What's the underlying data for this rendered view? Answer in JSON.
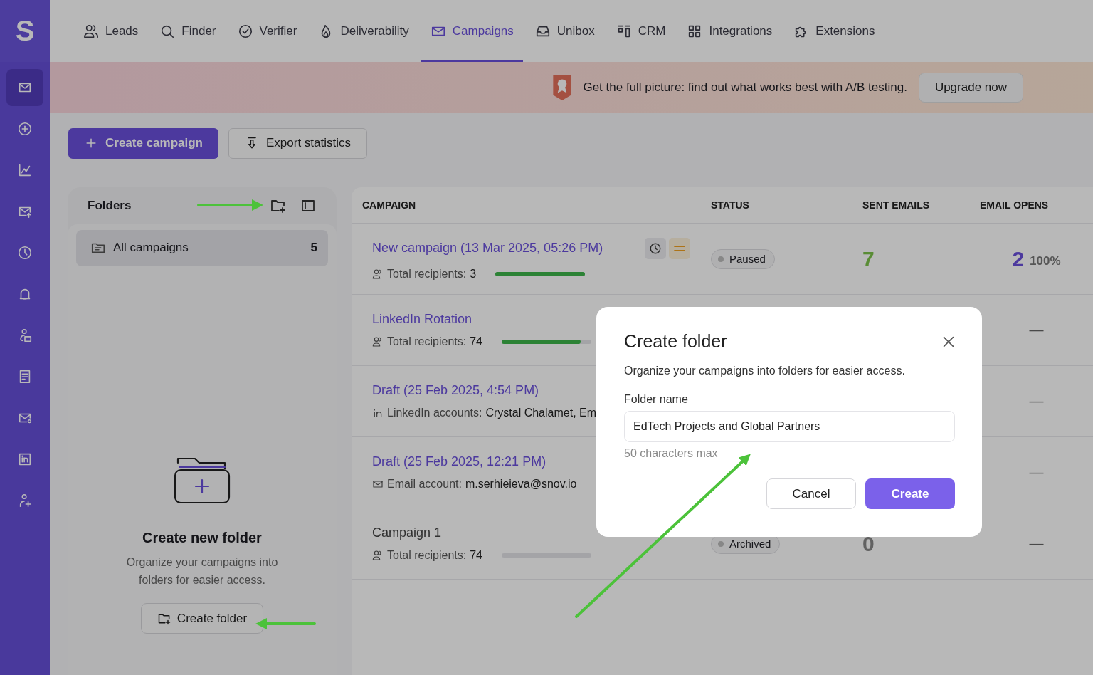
{
  "top_nav": {
    "logo": "S",
    "tabs": [
      {
        "label": "Leads",
        "selected": false
      },
      {
        "label": "Finder",
        "selected": false
      },
      {
        "label": "Verifier",
        "selected": false
      },
      {
        "label": "Deliverability",
        "selected": false
      },
      {
        "label": "Campaigns",
        "selected": true
      },
      {
        "label": "Unibox",
        "selected": false
      },
      {
        "label": "CRM",
        "selected": false
      },
      {
        "label": "Integrations",
        "selected": false
      },
      {
        "label": "Extensions",
        "selected": false
      }
    ]
  },
  "sidebar": {
    "items": [
      {
        "selected": true
      },
      {
        "selected": false
      },
      {
        "selected": false
      },
      {
        "selected": false
      },
      {
        "selected": false
      },
      {
        "selected": false
      },
      {
        "selected": false
      },
      {
        "selected": false
      },
      {
        "selected": false
      },
      {
        "selected": false
      },
      {
        "selected": false
      }
    ]
  },
  "banner": {
    "text": "Get the full picture: find out what works best with A/B testing.",
    "button": "Upgrade now"
  },
  "toolbar": {
    "buttons": [
      {
        "label": "Create campaign",
        "kind": "primary"
      },
      {
        "label": "Export statistics",
        "kind": "secondary"
      }
    ]
  },
  "folders": {
    "title": "Folders",
    "items": [
      {
        "label": "All campaigns",
        "count": "5",
        "selected": true
      }
    ],
    "empty_state": {
      "title": "Create new folder",
      "text": "Organize your campaigns into folders for easier access.",
      "button": "Create folder"
    }
  },
  "table": {
    "columns": [
      "CAMPAIGN",
      "STATUS",
      "SENT EMAILS",
      "EMAIL OPENS"
    ],
    "rows": [
      {
        "name": "New campaign (13 Mar 2025, 05:26 PM)",
        "archived": false,
        "actions": true,
        "detail": {
          "kind": "recipients",
          "label": "Total recipients:",
          "value": "3"
        },
        "level": 1,
        "status": "Paused",
        "sent": "7",
        "opens": "2",
        "open_rate": "100%"
      },
      {
        "name": "LinkedIn Rotation",
        "archived": false,
        "detail": {
          "kind": "recipients",
          "label": "Total recipients:",
          "value": "74"
        },
        "level": 0.88,
        "opens": "—"
      },
      {
        "name": "Draft (25 Feb 2025, 4:54 PM)",
        "archived": false,
        "detail": {
          "kind": "linkedin",
          "label": "LinkedIn accounts:",
          "value": "Crystal Chalamet, Em"
        },
        "opens": "—"
      },
      {
        "name": "Draft (25 Feb 2025, 12:21 PM)",
        "archived": false,
        "detail": {
          "kind": "email",
          "label": "Email account:",
          "value": "m.serhieieva@snov.io"
        },
        "opens": "—"
      },
      {
        "name": "Campaign 1",
        "archived": true,
        "detail": {
          "kind": "recipients",
          "label": "Total recipients:",
          "value": "74"
        },
        "level": 0,
        "status": "Archived",
        "sent": "0",
        "opens": "—"
      }
    ]
  },
  "modal": {
    "title": "Create folder",
    "text": "Organize your campaigns into folders for easier access.",
    "field": {
      "label": "Folder name",
      "value": "EdTech Projects and Global Partners",
      "hint": "50 characters max"
    },
    "buttons": [
      {
        "label": "Cancel",
        "kind": "secondary"
      },
      {
        "label": "Create",
        "kind": "primary"
      }
    ]
  }
}
